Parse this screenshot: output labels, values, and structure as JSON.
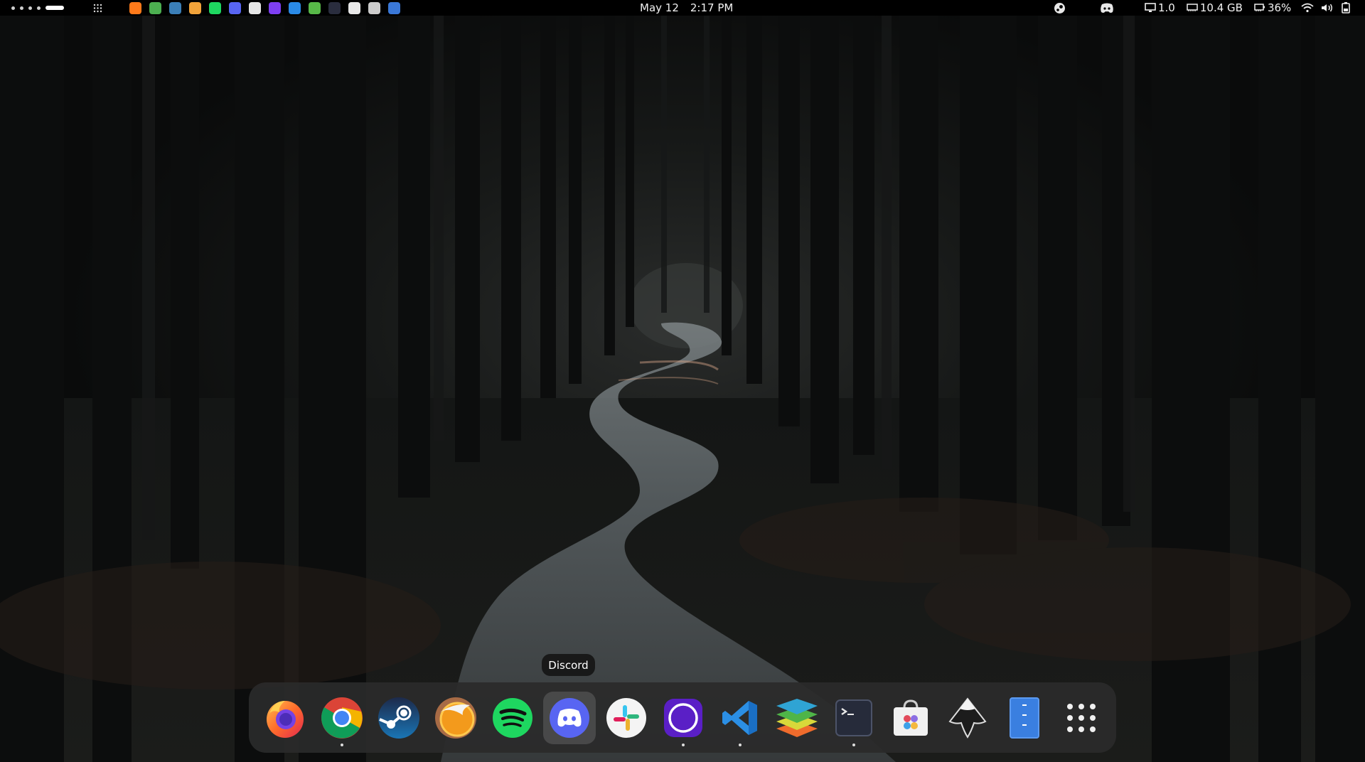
{
  "topbar": {
    "date": "May 12",
    "time": "2:17 PM",
    "load": "1.0",
    "memory": "10.4 GB",
    "battery": "36%",
    "running_apps": [
      {
        "name": "firefox",
        "color": "#ff7a1a"
      },
      {
        "name": "chrome",
        "color": "#4caf50"
      },
      {
        "name": "steam",
        "color": "#3b7fb8"
      },
      {
        "name": "hypnotix",
        "color": "#f2a33a"
      },
      {
        "name": "spotify",
        "color": "#1ed760"
      },
      {
        "name": "discord",
        "color": "#5865f2"
      },
      {
        "name": "slack",
        "color": "#e6e6e6"
      },
      {
        "name": "tor",
        "color": "#7e3ff2"
      },
      {
        "name": "vscode",
        "color": "#2a8ae6"
      },
      {
        "name": "stacks",
        "color": "#58b848"
      },
      {
        "name": "terminal",
        "color": "#2a2d3e"
      },
      {
        "name": "store",
        "color": "#e8e8e8"
      },
      {
        "name": "inkscape",
        "color": "#cccccc"
      },
      {
        "name": "archive",
        "color": "#3a78d8"
      }
    ]
  },
  "tooltip": {
    "label": "Discord"
  },
  "dock": {
    "items": [
      {
        "name": "Firefox",
        "icon": "firefox-icon",
        "running": false
      },
      {
        "name": "Google Chrome",
        "icon": "chrome-icon",
        "running": true
      },
      {
        "name": "Steam",
        "icon": "steam-icon",
        "running": false
      },
      {
        "name": "Hypnotix",
        "icon": "hypnotix-icon",
        "running": false
      },
      {
        "name": "Spotify",
        "icon": "spotify-icon",
        "running": false
      },
      {
        "name": "Discord",
        "icon": "discord-icon",
        "running": false
      },
      {
        "name": "Slack",
        "icon": "slack-icon",
        "running": false
      },
      {
        "name": "Tor Browser",
        "icon": "tor-icon",
        "running": true
      },
      {
        "name": "Visual Studio Code",
        "icon": "vscode-icon",
        "running": true
      },
      {
        "name": "Stacks",
        "icon": "layers-icon",
        "running": false
      },
      {
        "name": "Terminal",
        "icon": "terminal-icon",
        "running": true
      },
      {
        "name": "Software Store",
        "icon": "store-bag-icon",
        "running": false
      },
      {
        "name": "Inkscape",
        "icon": "inkscape-icon",
        "running": false
      },
      {
        "name": "Archive Manager",
        "icon": "archive-icon",
        "running": false
      },
      {
        "name": "Show Applications",
        "icon": "app-grid-icon",
        "running": false
      }
    ]
  },
  "colors": {
    "topbar_bg": "#000000",
    "dock_bg": "#2a2a2a",
    "wallpaper_dark": "#0b0c0c",
    "road": "#5a6063"
  }
}
